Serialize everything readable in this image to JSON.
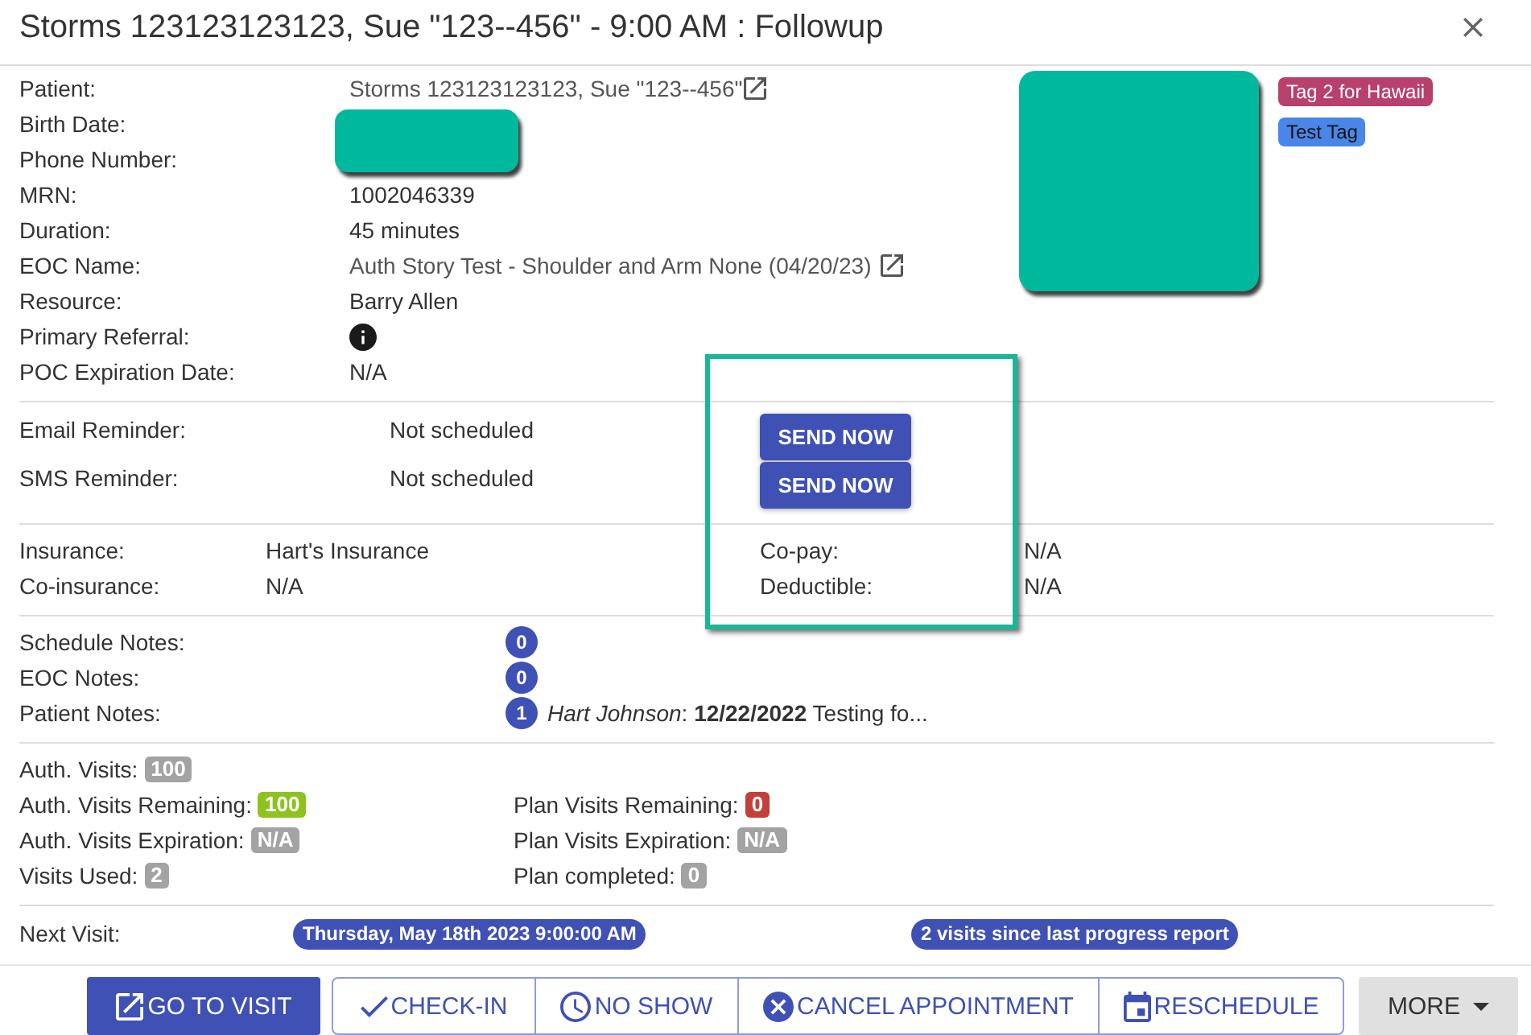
{
  "dialog": {
    "title": "Storms 123123123123, Sue \"123--456\" - 9:00 AM : Followup"
  },
  "patient_info": {
    "rows": [
      {
        "kind": "link",
        "label": "Patient:",
        "value": "Storms 123123123123, Sue \"123--456\""
      },
      {
        "kind": "blank",
        "label": "Birth Date:"
      },
      {
        "kind": "blank",
        "label": "Phone Number:"
      },
      {
        "kind": "text",
        "label": "MRN:",
        "value": "1002046339"
      },
      {
        "kind": "text",
        "label": "Duration:",
        "value": "45 minutes"
      },
      {
        "kind": "link",
        "label": "EOC Name:",
        "value": "Auth Story Test - Shoulder and Arm None (04/20/23)"
      },
      {
        "kind": "text",
        "label": "Resource:",
        "value": "Barry Allen"
      },
      {
        "kind": "info",
        "label": "Primary Referral:"
      },
      {
        "kind": "text",
        "label": "POC Expiration Date:",
        "value": "N/A"
      }
    ],
    "tags": [
      {
        "label": "Tag 2 for Hawaii",
        "color": "#b8406f"
      },
      {
        "label": "Test Tag",
        "color": "#4a86e8"
      }
    ]
  },
  "reminders": [
    {
      "label": "Email Reminder:",
      "status": "Not scheduled",
      "action": "SEND NOW"
    },
    {
      "label": "SMS Reminder:",
      "status": "Not scheduled",
      "action": "SEND NOW"
    }
  ],
  "insurance": {
    "left": [
      {
        "label": "Insurance:",
        "value": "Hart's Insurance"
      },
      {
        "label": "Co-insurance:",
        "value": "N/A"
      }
    ],
    "right": [
      {
        "label": "Co-pay:",
        "value": "N/A"
      },
      {
        "label": "Deductible:",
        "value": "N/A"
      }
    ]
  },
  "notes": [
    {
      "label": "Schedule Notes:",
      "count": "0"
    },
    {
      "label": "EOC Notes:",
      "count": "0"
    },
    {
      "label": "Patient Notes:",
      "count": "1",
      "preview": "*Hart Johnson*: **12/22/2022** Testing fo..."
    }
  ],
  "authorization": {
    "rows": [
      {
        "items": [
          {
            "label": "Auth. Visits:",
            "value": "100",
            "color": "#a3a3a3"
          }
        ]
      },
      {
        "items": [
          {
            "label": "Auth. Visits Remaining:",
            "value": "100",
            "color": "#8dc21f"
          },
          {
            "label": "Plan Visits Remaining:",
            "value": "0",
            "color": "#c23f3a"
          }
        ]
      },
      {
        "items": [
          {
            "label": "Auth. Visits Expiration:",
            "value": "N/A",
            "color": "#a3a3a3"
          },
          {
            "label": "Plan Visits Expiration:",
            "value": "N/A",
            "color": "#a3a3a3"
          }
        ]
      },
      {
        "items": [
          {
            "label": "Visits Used:",
            "value": "2",
            "color": "#a3a3a3"
          },
          {
            "label": "Plan completed:",
            "value": "0",
            "color": "#a3a3a3"
          }
        ]
      }
    ]
  },
  "next_visit": {
    "label": "Next Visit:",
    "date": "Thursday, May 18th 2023 9:00:00 AM",
    "progress": "2 visits since last progress report"
  },
  "actions": {
    "primary": "GO TO VISIT",
    "group": [
      {
        "kind": "check_in",
        "label": "CHECK-IN"
      },
      {
        "kind": "no_show",
        "label": "NO SHOW"
      },
      {
        "kind": "cancel",
        "label": "CANCEL APPOINTMENT"
      },
      {
        "kind": "reschedule",
        "label": "RESCHEDULE"
      }
    ],
    "more": "MORE"
  }
}
